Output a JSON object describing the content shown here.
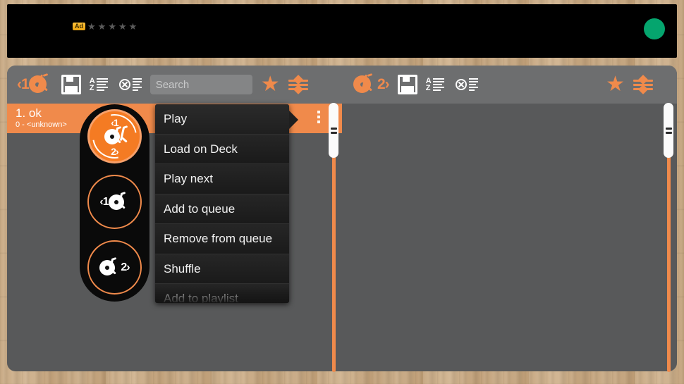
{
  "ad": {
    "badge_label": "Ad",
    "stars": [
      "★",
      "★",
      "★",
      "★",
      "★"
    ],
    "star_color": "#5b5b5b",
    "badge_color": "#e9a310",
    "dot_color": "#05a56e"
  },
  "toolbar": {
    "accent_color": "#f08a4b",
    "background": "#6d6e6f",
    "left": {
      "deck_label": "‹1",
      "deck_icon": "turntable-icon",
      "save_icon": "save-icon",
      "sort_icon": "sort-az-icon",
      "clear_icon": "clear-list-icon",
      "star_icon": "star-icon",
      "filter_icon": "filter-icon"
    },
    "right": {
      "deck_label": "2›",
      "deck_icon": "turntable-icon",
      "save_icon": "save-icon",
      "sort_icon": "sort-az-icon",
      "clear_icon": "clear-list-icon",
      "star_icon": "star-icon",
      "filter_icon": "filter-icon"
    }
  },
  "search": {
    "placeholder": "Search",
    "value": ""
  },
  "left_pane": {
    "selected_row": {
      "title": "1. ok",
      "subtitle": "0 - <unknown>",
      "background": "#f08a4b",
      "kebab_icon": "more-options-icon"
    }
  },
  "deck_selector": {
    "both": {
      "top_label": "‹1",
      "bottom_label": "2›",
      "name": "load-both-decks"
    },
    "one": {
      "label": "‹1",
      "name": "load-deck-1"
    },
    "two": {
      "label": "2›",
      "name": "load-deck-2"
    }
  },
  "context_menu": {
    "items": [
      {
        "label": "Play"
      },
      {
        "label": "Load on Deck"
      },
      {
        "label": "Play next"
      },
      {
        "label": "Add to queue"
      },
      {
        "label": "Remove from queue"
      },
      {
        "label": "Shuffle"
      },
      {
        "label": "Add to playlist"
      }
    ]
  },
  "scrollbars": {
    "left": {
      "thumb_position_pct": 0,
      "track_color": "#f08a4b"
    },
    "right": {
      "thumb_position_pct": 0,
      "track_color": "#f08a4b"
    }
  }
}
